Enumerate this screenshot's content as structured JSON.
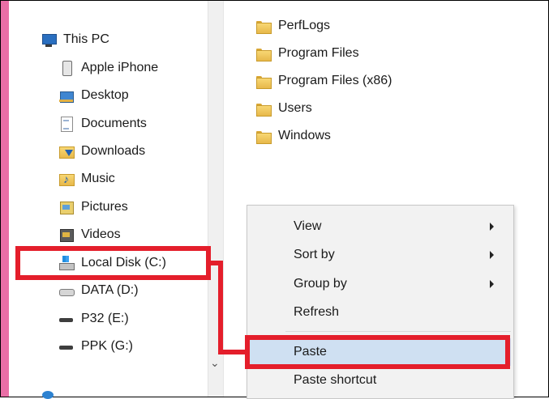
{
  "nav": {
    "this_pc": "This PC",
    "items": [
      {
        "label": "Apple iPhone",
        "icon": "phone-icon"
      },
      {
        "label": "Desktop",
        "icon": "desktop-icon"
      },
      {
        "label": "Documents",
        "icon": "documents-icon"
      },
      {
        "label": "Downloads",
        "icon": "downloads-icon"
      },
      {
        "label": "Music",
        "icon": "music-icon"
      },
      {
        "label": "Pictures",
        "icon": "pictures-icon"
      },
      {
        "label": "Videos",
        "icon": "videos-icon"
      },
      {
        "label": "Local Disk (C:)",
        "icon": "local-disk-icon"
      },
      {
        "label": "DATA (D:)",
        "icon": "drive-icon"
      },
      {
        "label": "P32 (E:)",
        "icon": "usb-drive-icon"
      },
      {
        "label": "PPK (G:)",
        "icon": "usb-drive-icon"
      }
    ]
  },
  "files": [
    {
      "name": "PerfLogs",
      "icon": "folder-icon"
    },
    {
      "name": "Program Files",
      "icon": "folder-icon"
    },
    {
      "name": "Program Files (x86)",
      "icon": "folder-icon"
    },
    {
      "name": "Users",
      "icon": "folder-icon"
    },
    {
      "name": "Windows",
      "icon": "folder-icon"
    }
  ],
  "context_menu": {
    "items": [
      {
        "label": "View",
        "submenu": true
      },
      {
        "label": "Sort by",
        "submenu": true
      },
      {
        "label": "Group by",
        "submenu": true
      },
      {
        "label": "Refresh",
        "submenu": false
      },
      {
        "label": "Paste",
        "submenu": false,
        "highlighted": true
      },
      {
        "label": "Paste shortcut",
        "submenu": false
      }
    ]
  },
  "colors": {
    "highlight_annotation": "#e41e2b",
    "menu_hover": "#cfe0f2",
    "side_accent": "#e96fa6"
  }
}
